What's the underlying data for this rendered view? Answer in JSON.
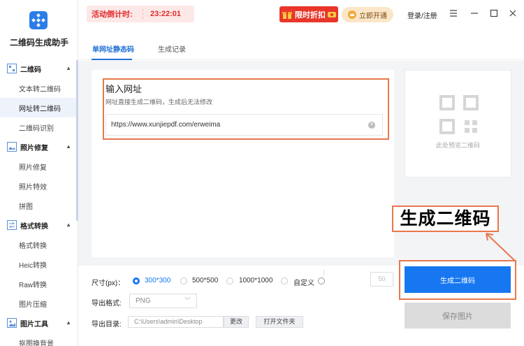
{
  "app": {
    "title": "二维码生成助手"
  },
  "sidebar": {
    "sections": [
      {
        "label": "二维码",
        "items": [
          "文本转二维码",
          "网址转二维码",
          "二维码识别"
        ]
      },
      {
        "label": "照片修复",
        "items": [
          "照片修复",
          "照片特效",
          "拼图"
        ]
      },
      {
        "label": "格式转换",
        "items": [
          "格式转换",
          "Heic转换",
          "Raw转换",
          "图片压缩"
        ]
      },
      {
        "label": "图片工具",
        "items": [
          "抠图换背景"
        ]
      }
    ],
    "active_item": "网址转二维码"
  },
  "topbar": {
    "countdown_label": "活动倒计时:",
    "countdown_time": "23:22:01",
    "promo_label": "限时折扣",
    "vip_label": "立即开通",
    "login_label": "登录/注册"
  },
  "tabs": [
    {
      "label": "单网址静态码",
      "active": true
    },
    {
      "label": "生成记录",
      "active": false
    }
  ],
  "input": {
    "title": "输入网址",
    "hint": "网址直接生成二维码，生成后无法修改",
    "value": "https://www.xunjiepdf.com/erweima"
  },
  "preview": {
    "placeholder": "此处预览二维码"
  },
  "callout": {
    "text": "生成二维码"
  },
  "options": {
    "size_label": "尺寸(px)：",
    "sizes": [
      "300*300",
      "500*500",
      "1000*1000",
      "自定义"
    ],
    "selected_size": "300*300",
    "custom_size_value": "50",
    "format_label": "导出格式:",
    "format_value": "PNG",
    "dir_label": "导出目录:",
    "dir_value": "C:\\Users\\admin\\Desktop",
    "change_label": "更改",
    "open_folder_label": "打开文件夹"
  },
  "buttons": {
    "generate_label": "生成二维码",
    "save_label": "保存图片"
  },
  "colors": {
    "primary": "#1677f0",
    "highlight_border": "#e8774d",
    "countdown_red": "#e02a2a",
    "promo_red": "#e8362a"
  }
}
